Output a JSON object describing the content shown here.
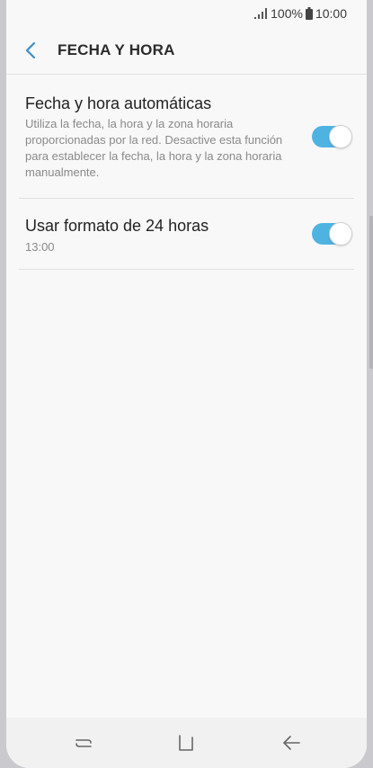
{
  "status_bar": {
    "signal_icon": "signal-bars-icon",
    "battery_percent": "100%",
    "battery_icon": "battery-icon",
    "time": "10:00"
  },
  "app_bar": {
    "back_icon": "chevron-left-icon",
    "title": "FECHA Y HORA"
  },
  "settings": [
    {
      "title": "Fecha y hora automáticas",
      "description": "Utiliza la fecha, la hora y la zona horaria proporcionadas por la red. Desactive esta función para establecer la fecha, la hora y la zona horaria manualmente.",
      "toggle_on": true
    },
    {
      "title": "Usar formato de 24 horas",
      "description": "13:00",
      "toggle_on": true
    }
  ],
  "nav_bar": {
    "recent_icon": "recent-apps-icon",
    "home_icon": "home-icon",
    "back_icon": "back-arrow-icon"
  },
  "colors": {
    "accent": "#4fb3e2",
    "background": "#f8f8f8"
  }
}
